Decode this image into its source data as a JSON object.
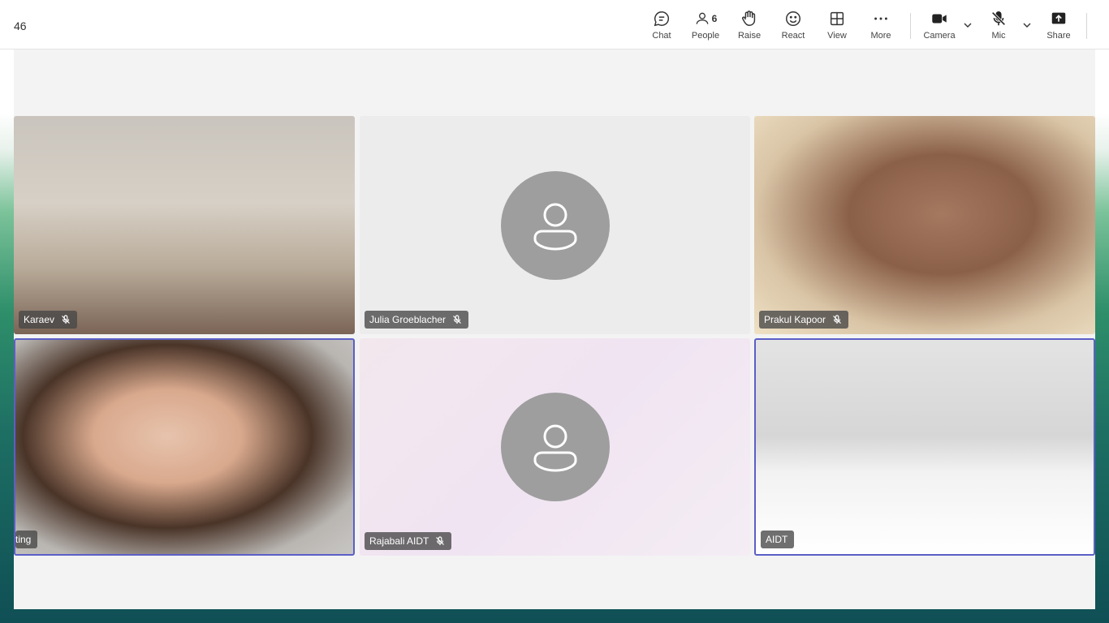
{
  "meeting": {
    "timer": "46"
  },
  "toolbar": {
    "chat_label": "Chat",
    "people_label": "People",
    "people_count": "6",
    "raise_label": "Raise",
    "react_label": "React",
    "view_label": "View",
    "more_label": "More",
    "camera_label": "Camera",
    "mic_label": "Mic",
    "share_label": "Share"
  },
  "participants": [
    {
      "name": "Karaev",
      "muted": true,
      "video": true
    },
    {
      "name": "Julia Groeblacher",
      "muted": true,
      "video": false
    },
    {
      "name": "Prakul Kapoor",
      "muted": true,
      "video": true
    },
    {
      "name": "ting",
      "muted": false,
      "video": true
    },
    {
      "name": "Rajabali AIDT",
      "muted": true,
      "video": false
    },
    {
      "name": "AIDT",
      "muted": false,
      "video": true
    }
  ],
  "colors": {
    "accent": "#5b5fc7",
    "avatar_bg": "#9e9e9e",
    "stage_bg": "#f3f3f3"
  }
}
